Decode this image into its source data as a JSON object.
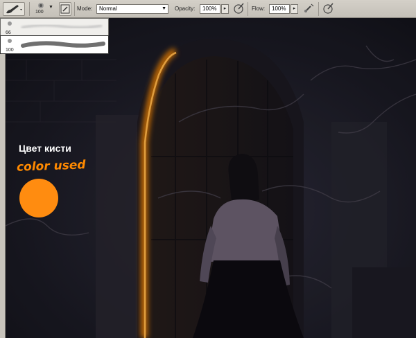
{
  "toolbar": {
    "brush_size": "100",
    "mode_label": "Mode:",
    "mode_value": "Normal",
    "opacity_label": "Opacity:",
    "opacity_value": "100%",
    "flow_label": "Flow:",
    "flow_value": "100%"
  },
  "brush_presets": [
    {
      "size": "66"
    },
    {
      "size": "100"
    }
  ],
  "canvas": {
    "caption_ru": "Цвет кисти",
    "caption_en": "color used",
    "swatch_color": "#ff8c10",
    "glow_color": "#ff8a00"
  },
  "icons": [
    "brush-icon",
    "toggle-brush-panel-icon",
    "airbrush-icon",
    "tablet-pressure-icon"
  ]
}
